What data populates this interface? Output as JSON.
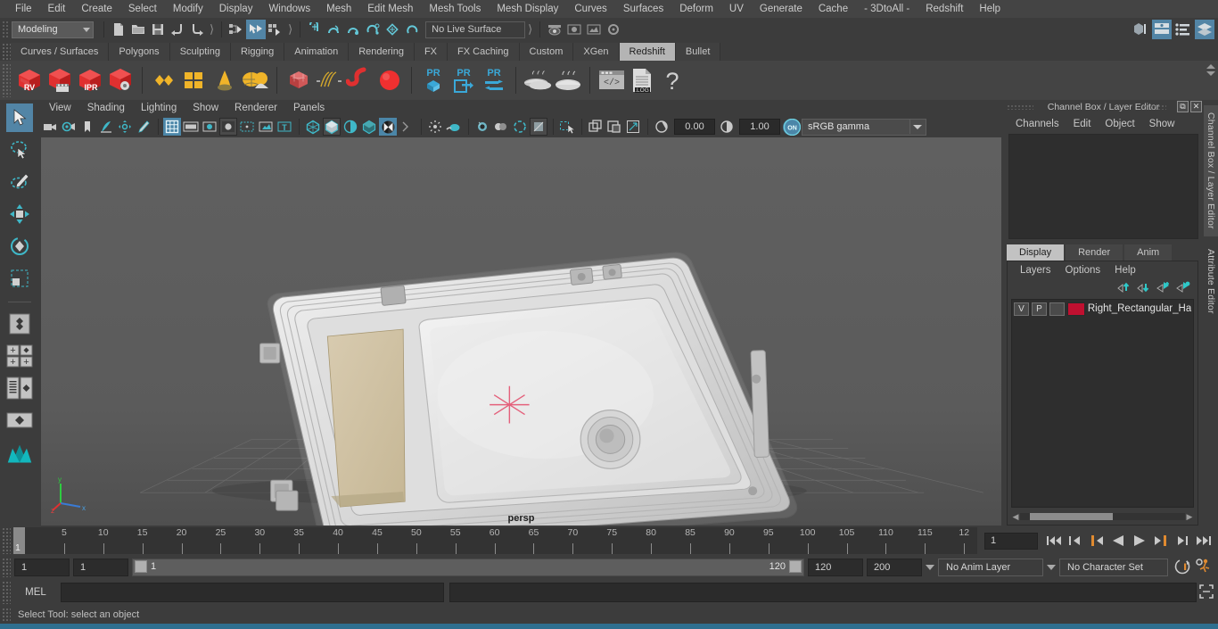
{
  "menubar": {
    "items": [
      "File",
      "Edit",
      "Create",
      "Select",
      "Modify",
      "Display",
      "Windows",
      "Mesh",
      "Edit Mesh",
      "Mesh Tools",
      "Mesh Display",
      "Curves",
      "Surfaces",
      "Deform",
      "UV",
      "Generate",
      "Cache",
      "- 3DtoAll -",
      "Redshift",
      "Help"
    ]
  },
  "statusline": {
    "mode": "Modeling",
    "live_surface": "No Live Surface",
    "icons": [
      "new-scene-icon",
      "open-scene-icon",
      "save-scene-icon",
      "undo-icon",
      "redo-icon",
      "select-hierarchy-icon",
      "select-object-icon",
      "select-component-icon",
      "snap-grid-icon",
      "snap-curve-icon",
      "snap-point-icon",
      "snap-projected-center-icon",
      "snap-view-plane-icon",
      "make-live-icon",
      "render-view-icon",
      "ipr-render-icon",
      "render-settings-icon",
      "render-globals-icon"
    ],
    "right_icons": [
      "show-hide-modeling-toolkit-icon",
      "show-hide-attribute-editor-icon",
      "show-hide-tool-settings-icon",
      "show-hide-channel-box-icon"
    ]
  },
  "shelf": {
    "tabs": [
      "Curves / Surfaces",
      "Polygons",
      "Sculpting",
      "Rigging",
      "Animation",
      "Rendering",
      "FX",
      "FX Caching",
      "Custom",
      "XGen",
      "Redshift",
      "Bullet"
    ],
    "active_tab": "Redshift",
    "buttons": [
      {
        "name": "redshift-render-view",
        "label": "RV"
      },
      {
        "name": "redshift-render-sequence",
        "label": ""
      },
      {
        "name": "redshift-ipr-render",
        "label": "IPR"
      },
      {
        "name": "redshift-render-settings",
        "label": ""
      },
      {
        "name": "redshift-material-diamond",
        "label": ""
      },
      {
        "name": "redshift-material-grid",
        "label": ""
      },
      {
        "name": "redshift-light-dome",
        "label": ""
      },
      {
        "name": "redshift-light-area",
        "label": ""
      },
      {
        "name": "redshift-environment",
        "label": ""
      },
      {
        "name": "redshift-proxy-cube",
        "label": ""
      },
      {
        "name": "redshift-hair",
        "label": ""
      },
      {
        "name": "redshift-volume",
        "label": ""
      },
      {
        "name": "redshift-sphere-light",
        "label": ""
      },
      {
        "name": "proxy-export-pr",
        "label": "PR"
      },
      {
        "name": "proxy-import-pr",
        "label": "PR"
      },
      {
        "name": "proxy-convert-pr",
        "label": "PR"
      },
      {
        "name": "bake-all-icon",
        "label": ""
      },
      {
        "name": "bake-selected-icon",
        "label": ""
      },
      {
        "name": "script-editor-icon",
        "label": ""
      },
      {
        "name": "log-file-icon",
        "label": ".LOG"
      },
      {
        "name": "help-icon",
        "label": "?"
      }
    ]
  },
  "toolbox": {
    "items": [
      "select-tool",
      "lasso-select-tool",
      "paint-select-tool",
      "move-tool",
      "rotate-tool",
      "scale-tool",
      "last-tool-used",
      "snap-toggle",
      "layout-single-pane",
      "layout-two-pane-side",
      "layout-two-pane-stacked",
      "layout-four-pane",
      "outliner-persp-layout",
      "persp-layout",
      "maya-logo"
    ]
  },
  "viewport": {
    "menu": [
      "View",
      "Shading",
      "Lighting",
      "Show",
      "Renderer",
      "Panels"
    ],
    "toolbar_icons": [
      "select-camera-icon",
      "camera-attributes-icon",
      "bookmark-icon",
      "image-plane-icon",
      "two-d-pan-zoom-icon",
      "grease-pencil-icon",
      "grid-toggle-icon",
      "film-gate-icon",
      "resolution-gate-icon",
      "gate-mask-icon",
      "film-origin-icon",
      "safe-action-icon",
      "title-safe-icon",
      "wireframe-icon",
      "smooth-shade-icon",
      "shade-hardware-texture-icon",
      "use-all-lights-icon",
      "shadows-icon",
      "screen-space-ao-icon",
      "motion-blur-icon",
      "multisample-icon",
      "depth-of-field-icon",
      "isolate-select-icon",
      "xray-icon",
      "xray-joints-icon",
      "xray-active-components-icon",
      "exposure-icon",
      "gamma-icon",
      "color-management-toggle-icon"
    ],
    "exposure_value": "0.00",
    "gamma_value": "1.00",
    "color_management_state": "ON",
    "view_transform": "sRGB gamma",
    "camera_label": "persp"
  },
  "right_dock": {
    "title": "Channel Box / Layer Editor",
    "window_buttons": [
      "undock-icon",
      "close-icon"
    ],
    "channel_menu": [
      "Channels",
      "Edit",
      "Object",
      "Show"
    ],
    "layer_tabs": [
      "Display",
      "Render",
      "Anim"
    ],
    "active_layer_tab": "Display",
    "layer_menu": [
      "Layers",
      "Options",
      "Help"
    ],
    "layer_tool_icons": [
      "move-layer-up-icon",
      "move-layer-down-icon",
      "create-new-layer-icon",
      "create-layer-from-selected-icon"
    ],
    "layers": [
      {
        "visibility": "V",
        "playback": "P",
        "type": "",
        "color": "#c01030",
        "name": "Right_Rectangular_Ha"
      }
    ],
    "side_tabs": [
      "Channel Box / Layer Editor",
      "Attribute Editor"
    ]
  },
  "timeline": {
    "start_label": "1",
    "tick_labels": [
      "5",
      "10",
      "15",
      "20",
      "25",
      "30",
      "35",
      "40",
      "45",
      "50",
      "55",
      "60",
      "65",
      "70",
      "75",
      "80",
      "85",
      "90",
      "95",
      "100",
      "105",
      "110",
      "115",
      "12"
    ],
    "current_frame": "1",
    "current_frame_field": "1",
    "transport_icons": [
      "go-to-start-icon",
      "step-back-keyframe-icon",
      "step-back-frame-icon",
      "play-backwards-icon",
      "play-forwards-icon",
      "step-forward-frame-icon",
      "step-forward-keyframe-icon",
      "go-to-end-icon"
    ]
  },
  "range": {
    "anim_start": "1",
    "playback_start": "1",
    "slider_start_label": "1",
    "slider_end_label": "120",
    "playback_end": "120",
    "anim_end": "200",
    "anim_layer": "No Anim Layer",
    "character_set": "No Character Set",
    "right_icons": [
      "auto-keyframe-icon",
      "animation-preferences-icon"
    ]
  },
  "mel": {
    "label": "MEL",
    "input_value": "",
    "output_value": "",
    "expand_icon": "expand-script-editor-icon"
  },
  "status": {
    "help_text": "Select Tool: select an object"
  },
  "colors": {
    "accent_blue": "#5285a6",
    "shelf_active": "#b4b4b4",
    "layer_color": "#c01030",
    "bg_dark": "#3c3c3c",
    "bg_menu": "#444444"
  }
}
